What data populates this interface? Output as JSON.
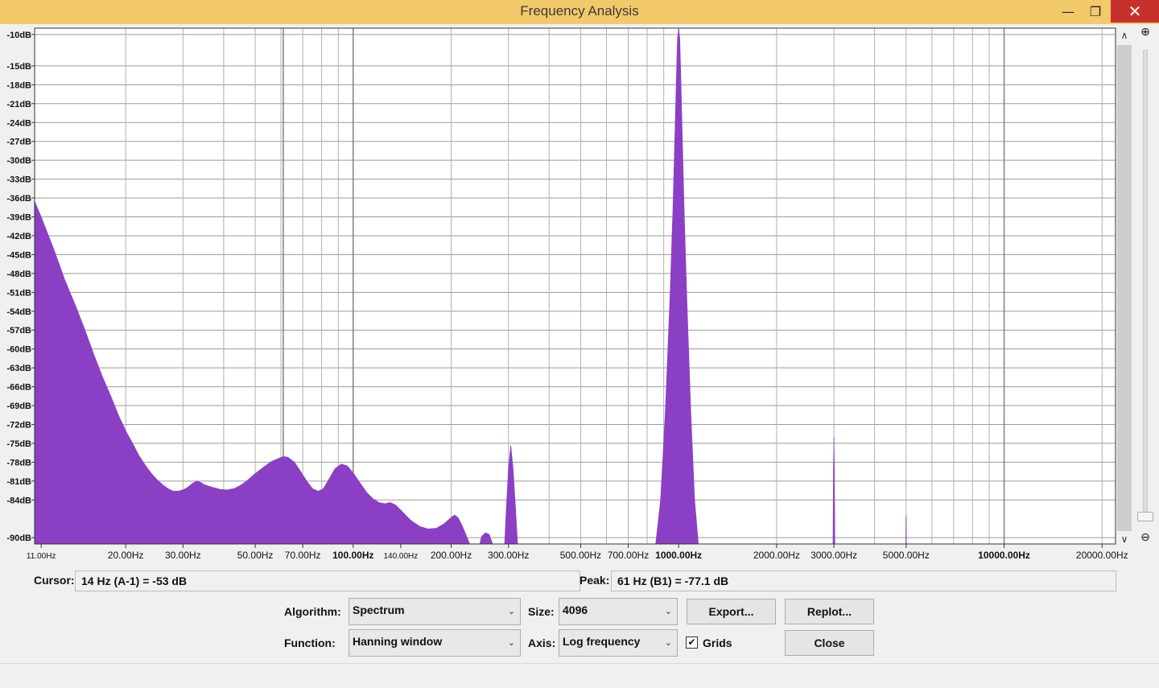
{
  "window": {
    "title": "Frequency Analysis",
    "min_glyph": "—",
    "max_glyph": "❐",
    "close_glyph": "✕"
  },
  "chart_data": {
    "type": "area",
    "x_scale": "log",
    "y_unit": "dB",
    "xlim": [
      10.5,
      22000
    ],
    "ylim": [
      -91,
      -9
    ],
    "grid": true,
    "fill_color": "#8b3fc4",
    "y_ticks": [
      {
        "value": -10,
        "label": "-10dB"
      },
      {
        "value": -15,
        "label": "-15dB"
      },
      {
        "value": -18,
        "label": "-18dB"
      },
      {
        "value": -21,
        "label": "-21dB"
      },
      {
        "value": -24,
        "label": "-24dB"
      },
      {
        "value": -27,
        "label": "-27dB"
      },
      {
        "value": -30,
        "label": "-30dB"
      },
      {
        "value": -33,
        "label": "-33dB"
      },
      {
        "value": -36,
        "label": "-36dB"
      },
      {
        "value": -39,
        "label": "-39dB"
      },
      {
        "value": -42,
        "label": "-42dB"
      },
      {
        "value": -45,
        "label": "-45dB"
      },
      {
        "value": -48,
        "label": "-48dB"
      },
      {
        "value": -51,
        "label": "-51dB"
      },
      {
        "value": -54,
        "label": "-54dB"
      },
      {
        "value": -57,
        "label": "-57dB"
      },
      {
        "value": -60,
        "label": "-60dB"
      },
      {
        "value": -63,
        "label": "-63dB"
      },
      {
        "value": -66,
        "label": "-66dB"
      },
      {
        "value": -69,
        "label": "-69dB"
      },
      {
        "value": -72,
        "label": "-72dB"
      },
      {
        "value": -75,
        "label": "-75dB"
      },
      {
        "value": -78,
        "label": "-78dB"
      },
      {
        "value": -81,
        "label": "-81dB"
      },
      {
        "value": -84,
        "label": "-84dB"
      },
      {
        "value": -90,
        "label": "-90dB"
      }
    ],
    "x_ticks": [
      {
        "value": 11,
        "label": "11.00Hz",
        "small": true
      },
      {
        "value": 20,
        "label": "20.00Hz"
      },
      {
        "value": 30,
        "label": "30.00Hz"
      },
      {
        "value": 50,
        "label": "50.00Hz"
      },
      {
        "value": 70,
        "label": "70.00Hz"
      },
      {
        "value": 100,
        "label": "100.00Hz",
        "bold": true
      },
      {
        "value": 140,
        "label": "140.00Hz",
        "small": true
      },
      {
        "value": 200,
        "label": "200.00Hz"
      },
      {
        "value": 300,
        "label": "300.00Hz"
      },
      {
        "value": 500,
        "label": "500.00Hz"
      },
      {
        "value": 700,
        "label": "700.00Hz"
      },
      {
        "value": 1000,
        "label": "1000.00Hz",
        "bold": true
      },
      {
        "value": 2000,
        "label": "2000.00Hz"
      },
      {
        "value": 3000,
        "label": "3000.00Hz"
      },
      {
        "value": 5000,
        "label": "5000.00Hz"
      },
      {
        "value": 10000,
        "label": "10000.00Hz",
        "bold": true
      },
      {
        "value": 20000,
        "label": "20000.00Hz"
      }
    ],
    "x_grid": [
      20,
      30,
      40,
      50,
      60,
      70,
      80,
      90,
      100,
      200,
      300,
      400,
      500,
      600,
      700,
      800,
      900,
      1000,
      2000,
      3000,
      4000,
      5000,
      6000,
      7000,
      8000,
      9000,
      10000,
      20000
    ],
    "x_grid_major": [
      61,
      100,
      1000,
      10000
    ],
    "series": [
      {
        "points": [
          [
            10.5,
            -36.5
          ],
          [
            11,
            -39
          ],
          [
            12,
            -44
          ],
          [
            13,
            -49
          ],
          [
            14,
            -53
          ],
          [
            15,
            -57
          ],
          [
            16,
            -61
          ],
          [
            17,
            -64.5
          ],
          [
            18,
            -67.5
          ],
          [
            19,
            -70.5
          ],
          [
            20,
            -73
          ],
          [
            21,
            -75
          ],
          [
            22,
            -77
          ],
          [
            23,
            -78.5
          ],
          [
            24,
            -79.8
          ],
          [
            25,
            -80.8
          ],
          [
            26,
            -81.6
          ],
          [
            27,
            -82.2
          ],
          [
            28,
            -82.6
          ],
          [
            29,
            -82.6
          ],
          [
            30,
            -82.4
          ],
          [
            31,
            -82
          ],
          [
            32,
            -81.4
          ],
          [
            33,
            -81
          ],
          [
            34,
            -81.2
          ],
          [
            35,
            -81.6
          ],
          [
            37,
            -82
          ],
          [
            39,
            -82.3
          ],
          [
            41,
            -82.4
          ],
          [
            43,
            -82.2
          ],
          [
            45,
            -81.7
          ],
          [
            47,
            -81
          ],
          [
            50,
            -79.8
          ],
          [
            53,
            -78.8
          ],
          [
            56,
            -77.9
          ],
          [
            59,
            -77.4
          ],
          [
            61,
            -77.1
          ],
          [
            63,
            -77.2
          ],
          [
            66,
            -78
          ],
          [
            69,
            -79.5
          ],
          [
            72,
            -81
          ],
          [
            75,
            -82.2
          ],
          [
            78,
            -82.6
          ],
          [
            81,
            -82.2
          ],
          [
            84,
            -80.8
          ],
          [
            88,
            -79
          ],
          [
            92,
            -78.3
          ],
          [
            96,
            -78.6
          ],
          [
            100,
            -79.7
          ],
          [
            105,
            -81.3
          ],
          [
            110,
            -82.8
          ],
          [
            115,
            -83.8
          ],
          [
            120,
            -84.4
          ],
          [
            125,
            -84.6
          ],
          [
            130,
            -84.4
          ],
          [
            135,
            -84.8
          ],
          [
            140,
            -85.6
          ],
          [
            150,
            -87.2
          ],
          [
            160,
            -88.2
          ],
          [
            170,
            -88.6
          ],
          [
            180,
            -88.5
          ],
          [
            190,
            -87.8
          ],
          [
            200,
            -86.8
          ],
          [
            205,
            -86.4
          ],
          [
            210,
            -86.8
          ],
          [
            215,
            -87.8
          ],
          [
            222,
            -89.5
          ],
          [
            228,
            -91
          ],
          [
            233,
            -91
          ],
          [
            245,
            -91
          ],
          [
            248,
            -89.8
          ],
          [
            255,
            -89.2
          ],
          [
            262,
            -89.5
          ],
          [
            268,
            -91
          ],
          [
            292,
            -91
          ],
          [
            295,
            -86
          ],
          [
            300,
            -79
          ],
          [
            305,
            -75.3
          ],
          [
            310,
            -79
          ],
          [
            316,
            -86
          ],
          [
            320,
            -91
          ],
          [
            850,
            -91
          ],
          [
            880,
            -84
          ],
          [
            910,
            -70
          ],
          [
            940,
            -52
          ],
          [
            960,
            -38
          ],
          [
            975,
            -25
          ],
          [
            985,
            -16
          ],
          [
            992,
            -10.5
          ],
          [
            1000,
            -9.2
          ],
          [
            1008,
            -10.5
          ],
          [
            1015,
            -16
          ],
          [
            1025,
            -25
          ],
          [
            1040,
            -38
          ],
          [
            1060,
            -52
          ],
          [
            1090,
            -70
          ],
          [
            1120,
            -84
          ],
          [
            1150,
            -91
          ],
          [
            2980,
            -91
          ],
          [
            2990,
            -79
          ],
          [
            3000,
            -74
          ],
          [
            3010,
            -79
          ],
          [
            3020,
            -91
          ],
          [
            4990,
            -91
          ],
          [
            4995,
            -87
          ],
          [
            5000,
            -86.5
          ],
          [
            5005,
            -87
          ],
          [
            5010,
            -91
          ],
          [
            22000,
            -91
          ]
        ]
      }
    ]
  },
  "cursor": {
    "label": "Cursor:",
    "value": "14 Hz (A-1) = -53 dB"
  },
  "peak": {
    "label": "Peak:",
    "value": "61 Hz (B1) = -77.1 dB"
  },
  "controls": {
    "algorithm_label": "Algorithm:",
    "algorithm_value": "Spectrum",
    "function_label": "Function:",
    "function_value": "Hanning window",
    "size_label": "Size:",
    "size_value": "4096",
    "axis_label": "Axis:",
    "axis_value": "Log frequency",
    "grids_label": "Grids",
    "grids_checked_glyph": "✔",
    "export_label": "Export...",
    "replot_label": "Replot...",
    "close_label": "Close",
    "caret_glyph": "⌄"
  },
  "scroll": {
    "up_glyph": "∧",
    "down_glyph": "∨",
    "zoom_in_glyph": "⊕",
    "zoom_out_glyph": "⊖"
  }
}
